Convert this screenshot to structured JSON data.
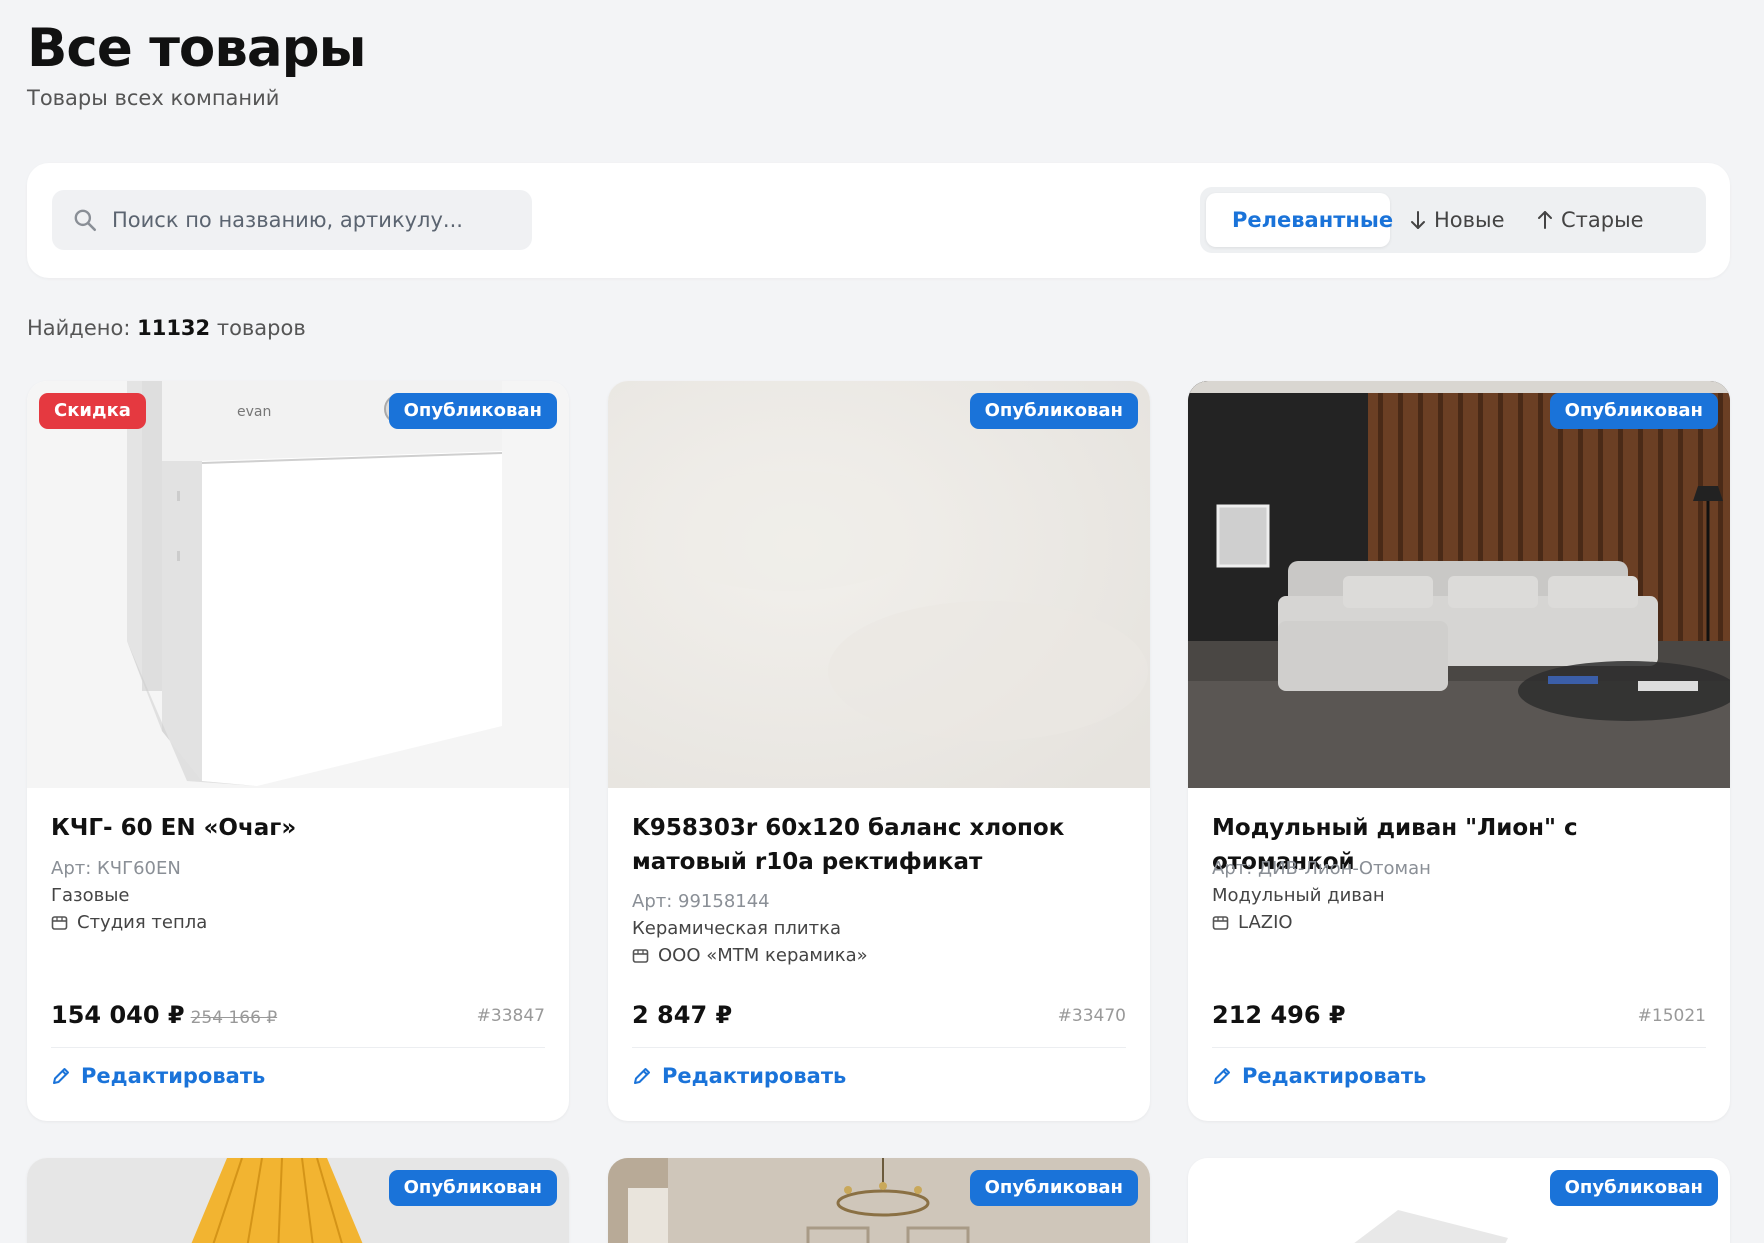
{
  "header": {
    "title": "Все товары",
    "subtitle": "Товары всех компаний"
  },
  "search": {
    "placeholder": "Поиск по названию, артикулу..."
  },
  "sort": {
    "relevant": "Релевантные",
    "newest": "Новые",
    "oldest": "Старые",
    "active": "relevant"
  },
  "results": {
    "prefix": "Найдено:",
    "count": "11132",
    "suffix": "товаров"
  },
  "colors": {
    "accent": "#1a73d9",
    "sale": "#e53940"
  },
  "products": [
    {
      "badge_sale": "Скидка",
      "status": "Опубликован",
      "title": "КЧГ- 60 EN «Очаг»",
      "sku": "Арт: КЧГ60EN",
      "category": "Газовые",
      "company": "Студия тепла",
      "price": "154 040 ₽",
      "old_price": "254 166 ₽",
      "id": "#33847",
      "edit": "Редактировать"
    },
    {
      "status": "Опубликован",
      "title": "K958303r 60x120 баланс хлопок матовый r10a ректификат",
      "sku": "Арт: 99158144",
      "category": "Керамическая плитка",
      "company": "ООО «МТМ керамика»",
      "price": "2 847 ₽",
      "id": "#33470",
      "edit": "Редактировать"
    },
    {
      "status": "Опубликован",
      "title": "Модульный диван \"Лион\" с отоманкой",
      "sku": "Арт: ДИВ-Лион-Отоман",
      "category": "Модульный диван",
      "company": "LAZIO",
      "price": "212 496 ₽",
      "id": "#15021",
      "edit": "Редактировать"
    },
    {
      "status": "Опубликован"
    },
    {
      "status": "Опубликован"
    },
    {
      "status": "Опубликован"
    }
  ]
}
